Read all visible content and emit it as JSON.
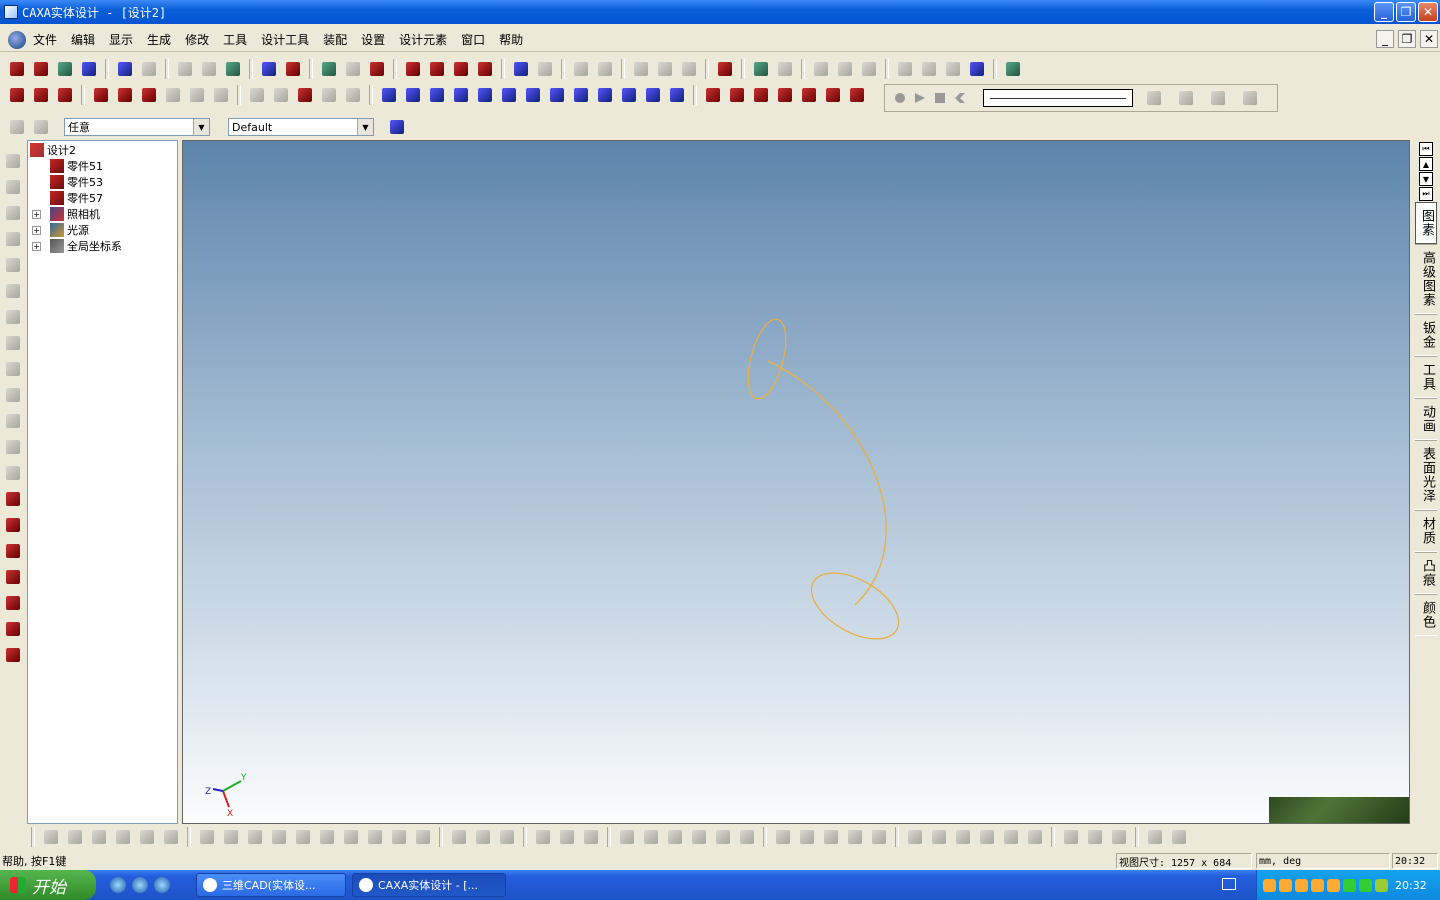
{
  "window": {
    "title": "CAXA实体设计 - [设计2]"
  },
  "menu": [
    "文件",
    "编辑",
    "显示",
    "生成",
    "修改",
    "工具",
    "设计工具",
    "装配",
    "设置",
    "设计元素",
    "窗口",
    "帮助"
  ],
  "selection_bar": {
    "filter_value": "任意",
    "style_value": "Default"
  },
  "tree": {
    "root": "设计2",
    "items": [
      "零件51",
      "零件53",
      "零件57",
      "照相机",
      "光源",
      "全局坐标系"
    ]
  },
  "viewport": {
    "axes": {
      "x": "X",
      "y": "Y",
      "z": "Z"
    },
    "curve_color": "#e8b040"
  },
  "right_tabs": [
    "图素",
    "高级图素",
    "钣金",
    "工具",
    "动画",
    "表面光泽",
    "材质",
    "凸痕",
    "颜色"
  ],
  "status": {
    "help": "帮助, 按F1键",
    "view_size": "视图尺寸: 1257 x  684",
    "units": "mm, deg",
    "time": "20:32"
  },
  "taskbar": {
    "start": "开始",
    "tasks": [
      "三维CAD(实体设...",
      "CAXA实体设计 - [..."
    ],
    "clock": "20:32"
  }
}
